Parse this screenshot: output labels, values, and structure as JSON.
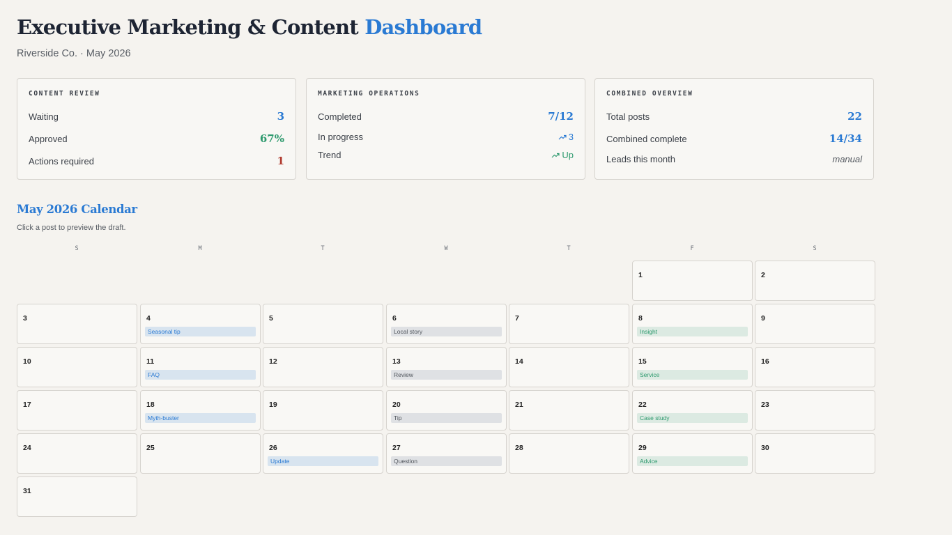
{
  "header": {
    "title_main": "Executive Marketing & Content",
    "title_accent": "Dashboard",
    "subtitle": "Riverside Co. · May 2026"
  },
  "cards": [
    {
      "title": "CONTENT REVIEW",
      "rows": [
        {
          "label": "Waiting",
          "value": "3"
        },
        {
          "label": "Approved",
          "value": "67%"
        },
        {
          "label": "Actions required",
          "value": "1"
        }
      ]
    },
    {
      "title": "MARKETING OPERATIONS",
      "rows": [
        {
          "label": "Completed",
          "value": "7/12"
        },
        {
          "label": "In progress",
          "value": "3"
        },
        {
          "label": "Trend",
          "value": "Up"
        }
      ]
    },
    {
      "title": "COMBINED OVERVIEW",
      "rows": [
        {
          "label": "Total posts",
          "value": "22"
        },
        {
          "label": "Combined complete",
          "value": "14/34"
        },
        {
          "label": "Leads this month",
          "value": "manual"
        }
      ]
    }
  ],
  "calendar": {
    "title": "May 2026 Calendar",
    "hint": "Click a post to preview the draft.",
    "weekdays": [
      "S",
      "M",
      "T",
      "W",
      "T",
      "F",
      "S"
    ],
    "days": [
      {
        "num": "1"
      },
      {
        "num": "2"
      },
      {
        "num": "3"
      },
      {
        "num": "4",
        "post": "Seasonal tip"
      },
      {
        "num": "5"
      },
      {
        "num": "6",
        "post": "Local story"
      },
      {
        "num": "7"
      },
      {
        "num": "8",
        "post": "Insight"
      },
      {
        "num": "9"
      },
      {
        "num": "10"
      },
      {
        "num": "11",
        "post": "FAQ"
      },
      {
        "num": "12"
      },
      {
        "num": "13",
        "post": "Review"
      },
      {
        "num": "14"
      },
      {
        "num": "15",
        "post": "Service"
      },
      {
        "num": "16"
      },
      {
        "num": "17"
      },
      {
        "num": "18",
        "post": "Myth-buster"
      },
      {
        "num": "19"
      },
      {
        "num": "20",
        "post": "Tip"
      },
      {
        "num": "21"
      },
      {
        "num": "22",
        "post": "Case study"
      },
      {
        "num": "23"
      },
      {
        "num": "24"
      },
      {
        "num": "25"
      },
      {
        "num": "26",
        "post": "Update"
      },
      {
        "num": "27",
        "post": "Question"
      },
      {
        "num": "28"
      },
      {
        "num": "29",
        "post": "Advice"
      },
      {
        "num": "30"
      },
      {
        "num": "31"
      }
    ]
  },
  "colors": {
    "accent": "#2a7ad3",
    "positive": "#2e9a6e",
    "alert": "#b03a2e",
    "background": "#f5f3ef"
  },
  "icons": {
    "trend": "trend-up-icon"
  }
}
